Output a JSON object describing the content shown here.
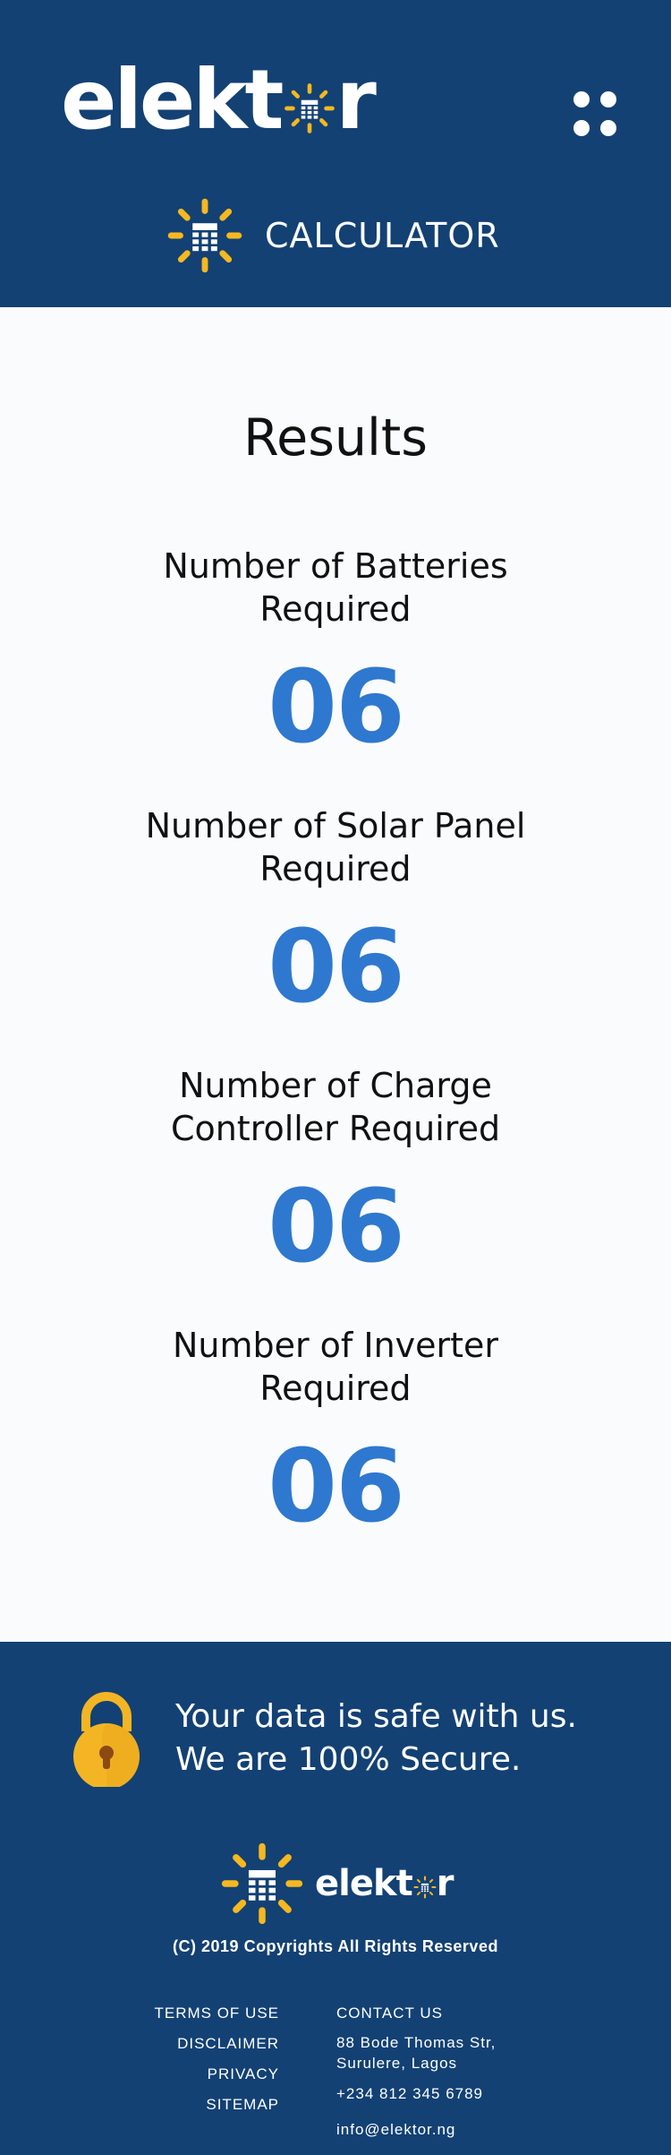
{
  "header": {
    "logo_prefix": "elekt",
    "logo_suffix": "r",
    "calculator_label": "CALCULATOR",
    "menu_icon": "grid-dots-icon"
  },
  "results": {
    "heading": "Results",
    "items": [
      {
        "label": "Number of Batteries Required",
        "value": "06"
      },
      {
        "label": "Number of Solar Panel Required",
        "value": "06"
      },
      {
        "label": "Number of Charge Controller Required",
        "value": "06"
      },
      {
        "label": "Number of Inverter Required",
        "value": "06"
      }
    ]
  },
  "footer": {
    "secure_line1": "Your data is safe with us.",
    "secure_line2": "We are 100% Secure.",
    "logo_prefix": "elekt",
    "logo_suffix": "r",
    "copyright": "(C) 2019 Copyrights All Rights Reserved",
    "links": [
      "TERMS OF USE",
      "DISCLAIMER",
      "PRIVACY",
      "SITEMAP"
    ],
    "contact_heading": "CONTACT US",
    "address": "88 Bode Thomas Str, Surulere, Lagos",
    "phone": "+234 812 345 6789",
    "email": "info@elektor.ng"
  },
  "colors": {
    "navy": "#134174",
    "accent_blue": "#2e78cf",
    "sun_yellow": "#f7b81f",
    "lock_yellow": "#f4b524",
    "background": "#fafbfd"
  }
}
